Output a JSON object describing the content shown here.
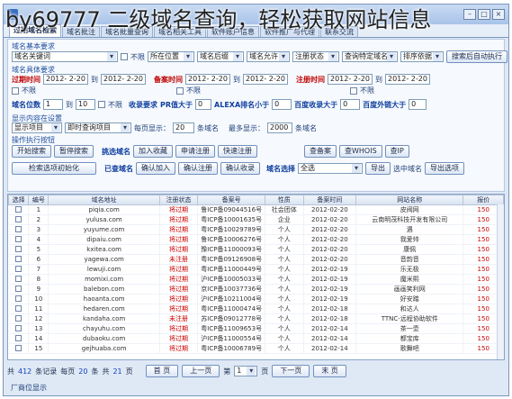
{
  "overlay_title": "by69777 二级域名查询，轻松获取网站信息",
  "window": {
    "title": ""
  },
  "tabs": [
    "过期域名检索",
    "域名批注",
    "域名批量查询",
    "域名相关工具",
    "软件账户信息",
    "软件推广与代理",
    "联系交流"
  ],
  "sections": {
    "basic": "域名基本要求",
    "detail": "域名具体要求",
    "display": "显示内容在设置",
    "ops": "操作执行按钮"
  },
  "form": {
    "keyword_select": "域名关键词",
    "unlimited": "不限",
    "location": "所在位置",
    "suffix": "域名后缀",
    "allow": "域名允许",
    "reg_status": "注册状态",
    "query_special": "查询特定域名",
    "sort": "排序依据",
    "search_reset": "搜索后自动执行",
    "expire_time_label": "过期时间",
    "expire_from": "2012- 2-20",
    "to_label": "到",
    "expire_to": "2012- 2-20",
    "record_time_label": "备案时间",
    "record_from": "2012- 2-20",
    "record_to": "2012- 2-20",
    "reg_time_label": "注册时间",
    "reg_from": "2012- 2-20",
    "reg_to": "2012- 2-20",
    "length_label": "域名位数",
    "length_from": "1",
    "length_to": "10",
    "record_req": "收录要求",
    "pr_label": "PR值大于",
    "pr_value": "0",
    "alexa_label": "ALEXA排名小于",
    "alexa_value": "0",
    "baidu_label": "百度收录大于",
    "baidu_value": "0",
    "backlink_label": "百度外链大于",
    "backlink_value": "0",
    "display_select": "显示项目",
    "query_mode": "即时查询项目",
    "per_page_label": "每页显示：",
    "per_page": "20",
    "per_page_unit": "条域名",
    "max_label": "最多显示：",
    "max_value": "2000",
    "max_unit": "条域名"
  },
  "buttons": {
    "start": "开始搜索",
    "pause": "暂停搜索",
    "reset": "检索选项初始化",
    "pick_label": "挑选域名",
    "add_fav": "加入收藏",
    "apply_reg": "申请注册",
    "quick_reg": "快速注册",
    "picked_label": "已查域名",
    "confirm_add": "确认加入",
    "confirm_reg": "确认注册",
    "confirm_rec": "确认收录",
    "choose_label": "域名选择",
    "choose_value": "全选",
    "export": "导出",
    "export_sel": "选中域名",
    "export_opt": "导出选项",
    "check_record": "查备案",
    "check_whois": "查WHOIS",
    "check_ip": "查IP"
  },
  "table": {
    "columns": [
      "选择",
      "编号",
      "域名地址",
      "注册状态",
      "备案号",
      "性质",
      "备案时间",
      "网站名称",
      "报价"
    ],
    "rows": [
      [
        "1",
        "piqia.com",
        "将过期",
        "鲁ICP备09044516号",
        "社会团体",
        "2012-02-20",
        "皮阀网",
        "150"
      ],
      [
        "2",
        "yulusa.com",
        "将过期",
        "粤ICP备10001635号",
        "企业",
        "2012-02-20",
        "云南明茂科技开发有限公司",
        "150"
      ],
      [
        "3",
        "yuyume.com",
        "将过期",
        "粤ICP备10029789号",
        "个人",
        "2012-02-20",
        "遇",
        "150"
      ],
      [
        "4",
        "dipaiu.com",
        "将过期",
        "鲁ICP备10006276号",
        "个人",
        "2012-02-20",
        "我爱帅",
        "150"
      ],
      [
        "5",
        "kxitea.com",
        "将过期",
        "豫ICP备11000093号",
        "个人",
        "2012-02-20",
        "康佩",
        "150"
      ],
      [
        "6",
        "yagewa.com",
        "未注册",
        "粤ICP备09126908号",
        "个人",
        "2012-02-20",
        "音韵音",
        "150"
      ],
      [
        "7",
        "lewuji.com",
        "将过期",
        "粤ICP备11000449号",
        "个人",
        "2012-02-19",
        "乐无极",
        "150"
      ],
      [
        "8",
        "momixi.com",
        "将过期",
        "沪ICP备10005033号",
        "个人",
        "2012-02-19",
        "魔米熙",
        "150"
      ],
      [
        "9",
        "balebon.com",
        "将过期",
        "京ICP备10037736号",
        "个人",
        "2012-02-19",
        "画画笑利网",
        "150"
      ],
      [
        "10",
        "haoanta.com",
        "将过期",
        "沪ICP备10211004号",
        "个人",
        "2012-02-19",
        "好安踏",
        "150"
      ],
      [
        "11",
        "hedaren.com",
        "将过期",
        "粤ICP备11000474号",
        "个人",
        "2012-02-18",
        "和达人",
        "150"
      ],
      [
        "12",
        "kandaha.com",
        "未注册",
        "苏ICP备09012778号",
        "个人",
        "2012-02-18",
        "TTNC-远程协助软件",
        "150"
      ],
      [
        "13",
        "chayuhu.com",
        "将过期",
        "粤ICP备11009653号",
        "个人",
        "2012-02-14",
        "茶一壶",
        "150"
      ],
      [
        "14",
        "dubaoku.com",
        "将过期",
        "沪ICP备11000554号",
        "个人",
        "2012-02-14",
        "都宝库",
        "150"
      ],
      [
        "15",
        "gejhuaba.com",
        "将过期",
        "粤ICP备10006789号",
        "个人",
        "2012-02-14",
        "歌舞吧",
        "150"
      ]
    ]
  },
  "pager": {
    "total_label": "共",
    "total": "412",
    "total_unit": "条记录",
    "per_label": "每页",
    "per": "20",
    "per_unit": "条",
    "pages_label": "共",
    "pages": "21",
    "pages_unit": "页",
    "first": "首 页",
    "prev": "上一页",
    "page_label": "第",
    "page": "1",
    "page_unit": "页",
    "next": "下一页",
    "last": "末 页"
  },
  "footer": "厂商位显示"
}
